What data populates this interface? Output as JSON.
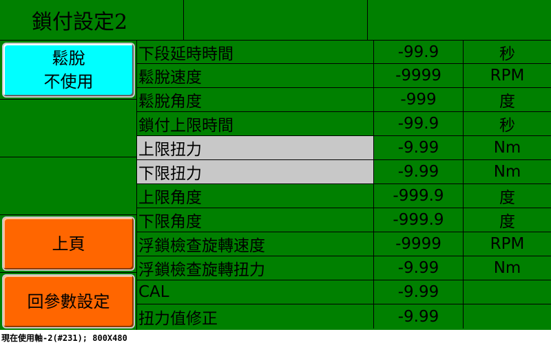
{
  "header": {
    "title": "鎖付設定2"
  },
  "sidebar": {
    "toggle_button": {
      "line1": "鬆脫",
      "line2": "不使用"
    },
    "prev_page_button": "上頁",
    "back_button": "回參數設定"
  },
  "params": [
    {
      "name": "下段延時時間",
      "value": "-99.9",
      "unit": "秒"
    },
    {
      "name": "鬆脫速度",
      "value": "-9999",
      "unit": "RPM"
    },
    {
      "name": "鬆脫角度",
      "value": "-999",
      "unit": "度"
    },
    {
      "name": "鎖付上限時間",
      "value": "-99.9",
      "unit": "秒"
    },
    {
      "name": "上限扭力",
      "value": "-9.99",
      "unit": "Nm"
    },
    {
      "name": "下限扭力",
      "value": "-9.99",
      "unit": "Nm"
    },
    {
      "name": "上限角度",
      "value": "-999.9",
      "unit": "度"
    },
    {
      "name": "下限角度",
      "value": "-999.9",
      "unit": "度"
    },
    {
      "name": "浮鎖檢查旋轉速度",
      "value": "-9999",
      "unit": "RPM"
    },
    {
      "name": "浮鎖檢查旋轉扭力",
      "value": "-9.99",
      "unit": "Nm"
    },
    {
      "name": "CAL",
      "value": "-9.99",
      "unit": ""
    },
    {
      "name": "扭力值修正",
      "value": "-9.99",
      "unit": ""
    }
  ],
  "colors": {
    "screen_bg": "#008000",
    "highlight": "#c8c8c8",
    "cyan_button": "#00ffff",
    "orange_button": "#ff6600"
  },
  "status_bar": "現在使用軸-2(#231); 800X480"
}
